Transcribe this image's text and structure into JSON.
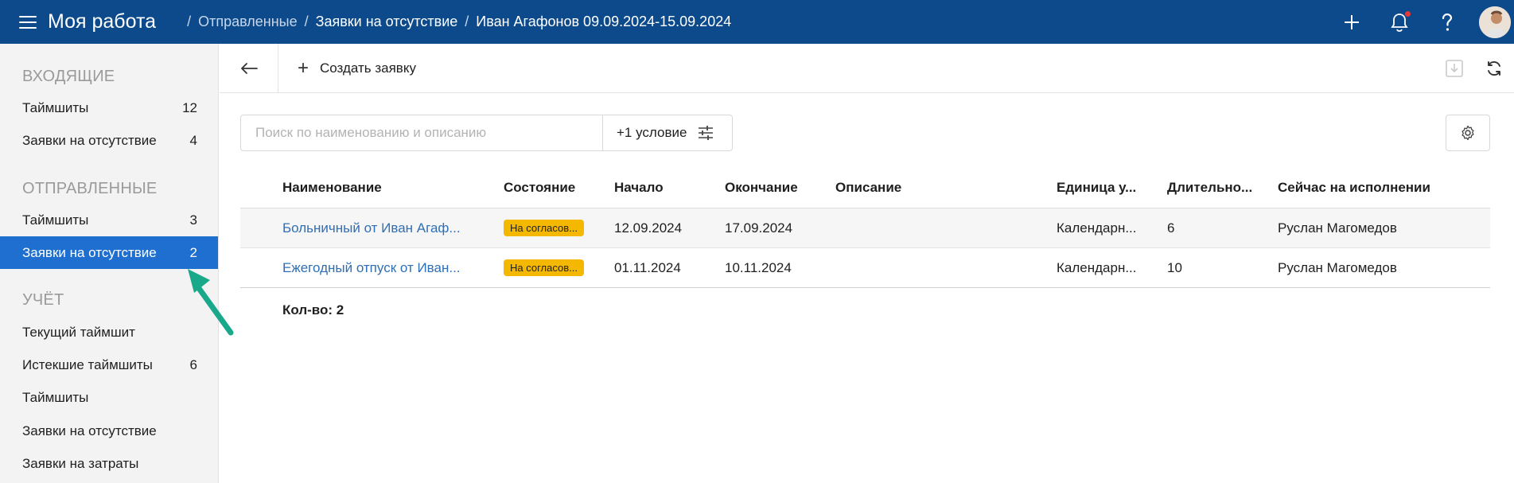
{
  "header": {
    "app_title": "Моя работа",
    "breadcrumb": [
      {
        "label": "Отправленные"
      },
      {
        "label": "Заявки на отсутствие"
      },
      {
        "label": "Иван Агафонов 09.09.2024-15.09.2024"
      }
    ],
    "accent_color": "#0c4a8c"
  },
  "sidebar": {
    "sections": [
      {
        "title": "ВХОДЯЩИЕ",
        "items": [
          {
            "label": "Таймшиты",
            "count": "12"
          },
          {
            "label": "Заявки на отсутствие",
            "count": "4"
          }
        ]
      },
      {
        "title": "ОТПРАВЛЕННЫЕ",
        "items": [
          {
            "label": "Таймшиты",
            "count": "3"
          },
          {
            "label": "Заявки на отсутствие",
            "count": "2",
            "active": true
          }
        ]
      },
      {
        "title": "УЧЁТ",
        "items": [
          {
            "label": "Текущий таймшит",
            "count": ""
          },
          {
            "label": "Истекшие таймшиты",
            "count": "6"
          },
          {
            "label": "Таймшиты",
            "count": ""
          },
          {
            "label": "Заявки на отсутствие",
            "count": ""
          },
          {
            "label": "Заявки на затраты",
            "count": ""
          }
        ]
      }
    ],
    "active_color": "#1f6fd1"
  },
  "toolbar": {
    "create_label": "Создать заявку"
  },
  "filter": {
    "search_placeholder": "Поиск по наименованию и описанию",
    "condition_label": "+1 условие"
  },
  "table": {
    "columns": {
      "name": "Наименование",
      "state": "Состояние",
      "start": "Начало",
      "end": "Окончание",
      "description": "Описание",
      "unit": "Единица у...",
      "duration": "Длительно...",
      "executor": "Сейчас на исполнении"
    },
    "rows": [
      {
        "name": "Больничный от Иван Агаф...",
        "state": "На согласов...",
        "start": "12.09.2024",
        "end": "17.09.2024",
        "description": "",
        "unit": "Календарн...",
        "duration": "6",
        "executor": "Руслан Магомедов"
      },
      {
        "name": "Ежегодный отпуск от Иван...",
        "state": "На согласов...",
        "start": "01.11.2024",
        "end": "10.11.2024",
        "description": "",
        "unit": "Календарн...",
        "duration": "10",
        "executor": "Руслан Магомедов"
      }
    ],
    "badge_color": "#f5b800",
    "link_color": "#2f6fb5"
  },
  "footer": {
    "count_label": "Кол-во: 2"
  },
  "annotation": {
    "arrow_color": "#19a98a"
  }
}
